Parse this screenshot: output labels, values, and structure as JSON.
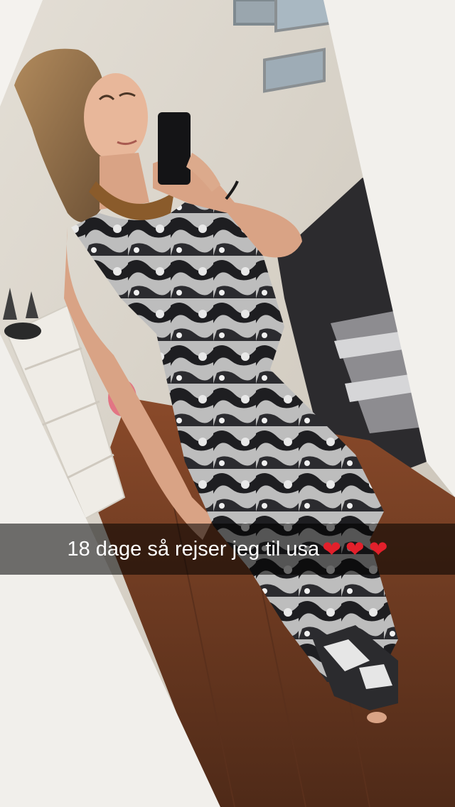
{
  "caption": {
    "text": "18 dage så rejser jeg til usa",
    "hearts": [
      "❤",
      "❤",
      "❤"
    ],
    "heart_color": "#e2202b"
  },
  "photo": {
    "subject": "mirror-selfie",
    "colors": {
      "wall": "#dcd6cc",
      "floor": "#6b3a22",
      "outfit_dark": "#1f1f22",
      "outfit_light": "#cfcfcf",
      "sofa": "#2c2b2e"
    }
  }
}
